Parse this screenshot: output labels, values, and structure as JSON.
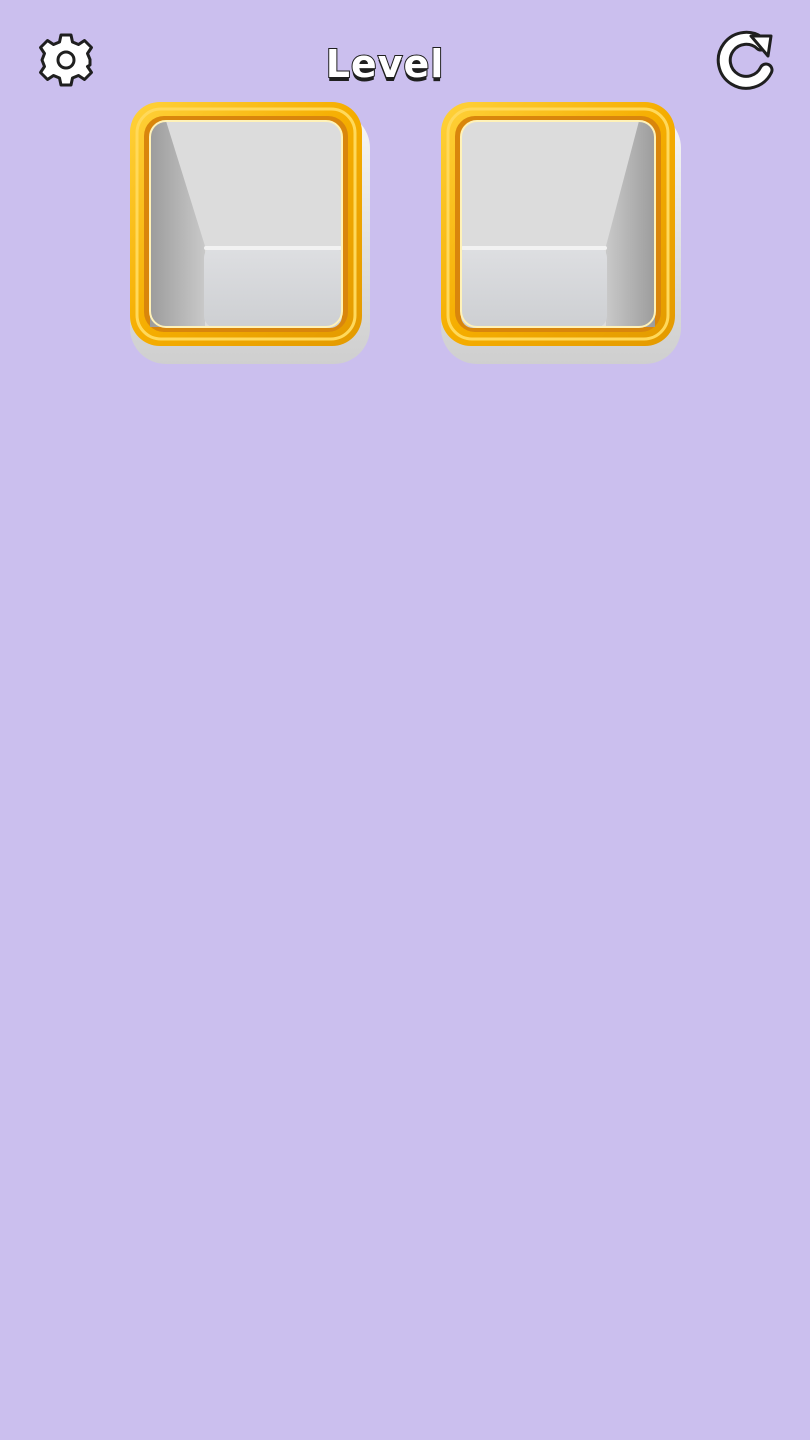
{
  "header": {
    "title": "Level",
    "settings_icon": "gear-icon",
    "restart_icon": "restart-arrow-icon"
  },
  "board": {
    "containers": [
      {
        "id": "box-1",
        "state": "empty",
        "inner_step": "right"
      },
      {
        "id": "box-2",
        "state": "empty",
        "inner_step": "left"
      }
    ]
  },
  "colors": {
    "background": "#cbbfee",
    "frame_gold": "#f5ad00",
    "frame_gold_light": "#ffd23a",
    "box_white": "#e8e8e8",
    "box_shadow": "#a9a9a9",
    "icon_fill": "#ffffff",
    "icon_outline": "#1f1f1f"
  }
}
